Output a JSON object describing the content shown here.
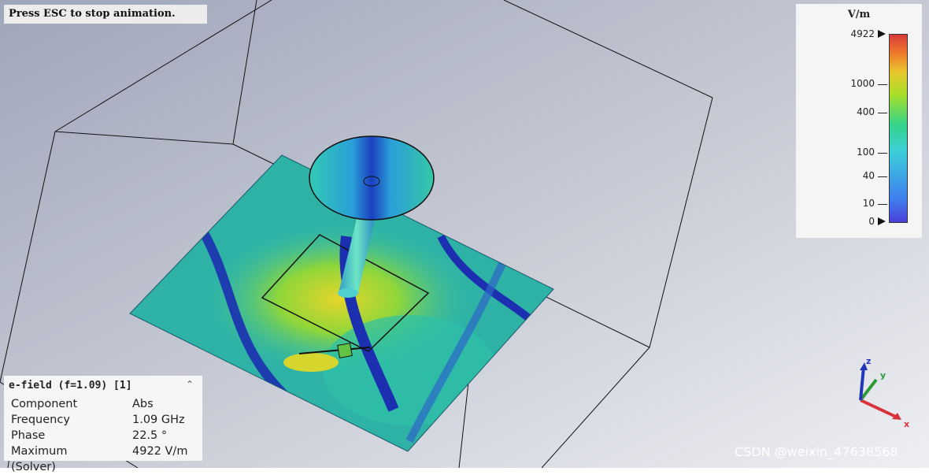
{
  "banner": {
    "text": "Press ESC to stop animation."
  },
  "legend": {
    "unit": "V/m",
    "ticks": [
      "4922",
      "1000",
      "400",
      "100",
      "40",
      "10",
      "0"
    ],
    "colors": [
      "#4a3fd8",
      "#3ad0d8",
      "#34d48a",
      "#e8c72e",
      "#d93a3a"
    ]
  },
  "info": {
    "title": "e-field (f=1.09) [1]",
    "collapse_icon": "chevron-up-icon",
    "rows": [
      {
        "key": "Component",
        "value": "Abs"
      },
      {
        "key": "Frequency",
        "value": "1.09 GHz"
      },
      {
        "key": "Phase",
        "value": "22.5 °"
      },
      {
        "key": "Maximum (Solver)",
        "value": "4922 V/m"
      }
    ]
  },
  "axes": {
    "x": "x",
    "y": "y",
    "z": "z"
  },
  "watermark": "CSDN @weixin_47638568"
}
